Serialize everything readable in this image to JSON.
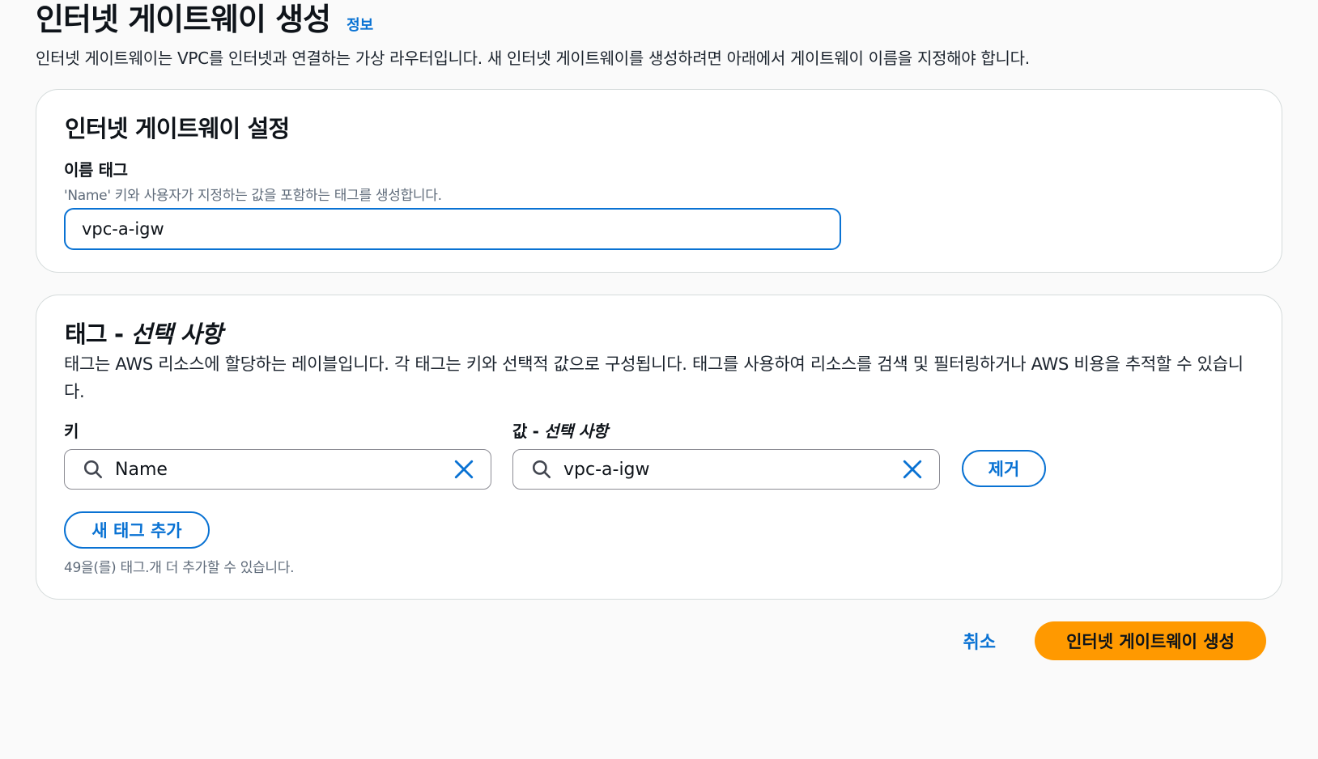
{
  "header": {
    "title": "인터넷 게이트웨이 생성",
    "info_link": "정보",
    "description": "인터넷 게이트웨이는 VPC를 인터넷과 연결하는 가상 라우터입니다. 새 인터넷 게이트웨이를 생성하려면 아래에서 게이트웨이 이름을 지정해야 합니다."
  },
  "settings": {
    "title": "인터넷 게이트웨이 설정",
    "name_tag_label": "이름 태그",
    "name_tag_desc": "'Name' 키와 사용자가 지정하는 값을 포함하는 태그를 생성합니다.",
    "name_tag_value": "vpc-a-igw"
  },
  "tags": {
    "title_main": "태그 - ",
    "title_optional": "선택 사항",
    "description": "태그는 AWS 리소스에 할당하는 레이블입니다. 각 태그는 키와 선택적 값으로 구성됩니다. 태그를 사용하여 리소스를 검색 및 필터링하거나 AWS 비용을 추적할 수 있습니다.",
    "key_label": "키",
    "value_label_main": "값 - ",
    "value_label_optional": "선택 사항",
    "rows": [
      {
        "key": "Name",
        "value": "vpc-a-igw"
      }
    ],
    "remove_label": "제거",
    "add_tag_label": "새 태그 추가",
    "limit_text": "49을(를) 태그.개 더 추가할 수 있습니다."
  },
  "footer": {
    "cancel_label": "취소",
    "create_label": "인터넷 게이트웨이 생성"
  },
  "colors": {
    "link": "#0972d3",
    "primary": "#ff9900",
    "border": "#d5dbdb"
  }
}
